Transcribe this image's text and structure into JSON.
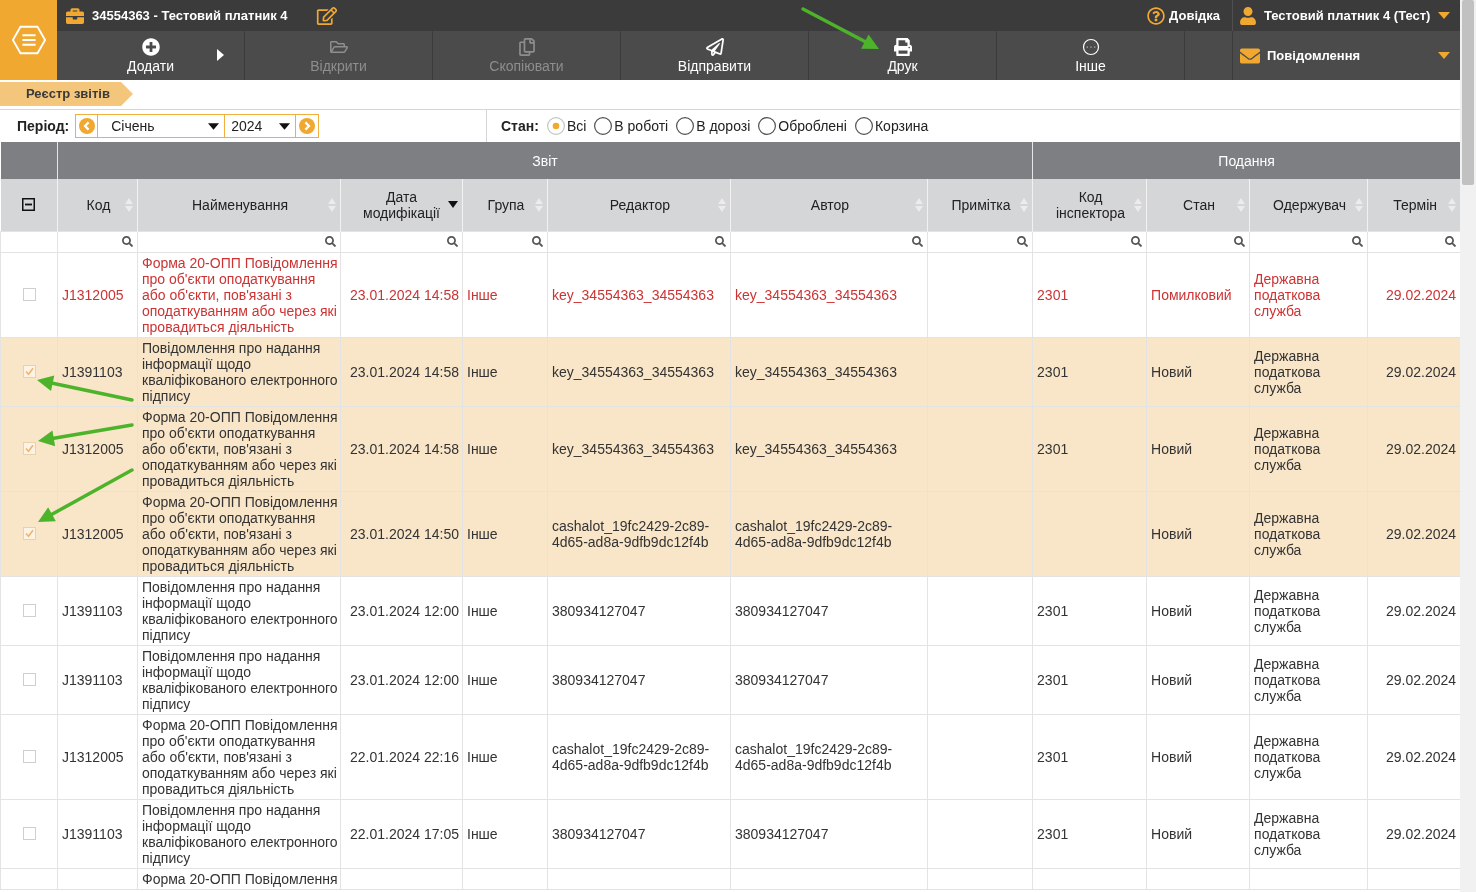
{
  "header": {
    "title": "34554363 - Тестовий платник 4",
    "help": "Довідка",
    "user": "Тестовий платник 4 (Тест)"
  },
  "toolbar": [
    {
      "label": "Додати",
      "disabled": false,
      "has_submenu": true
    },
    {
      "label": "Відкрити",
      "disabled": true,
      "has_submenu": false
    },
    {
      "label": "Скопіювати",
      "disabled": true,
      "has_submenu": false
    },
    {
      "label": "Відправити",
      "disabled": false,
      "has_submenu": false
    },
    {
      "label": "Друк",
      "disabled": false,
      "has_submenu": false
    },
    {
      "label": "Інше",
      "disabled": false,
      "has_submenu": false
    }
  ],
  "messages": {
    "label": "Повідомлення"
  },
  "breadcrumb": "Реєстр звітів",
  "filters": {
    "period_label": "Період:",
    "month": "Січень",
    "year": "2024",
    "status_label": "Стан:",
    "status_options": [
      {
        "label": "Всі",
        "selected": true
      },
      {
        "label": "В роботі",
        "selected": false
      },
      {
        "label": "В дорозі",
        "selected": false
      },
      {
        "label": "Оброблені",
        "selected": false
      },
      {
        "label": "Корзина",
        "selected": false
      }
    ]
  },
  "table": {
    "select_all": {
      "indeterminate": true
    },
    "column_groups": [
      {
        "label": "Звіт",
        "columns": [
          {
            "label": "Код",
            "sorted_descending": false
          },
          {
            "label": "Найменування",
            "sorted_descending": false
          },
          {
            "label": "Дата модифікації",
            "sorted_descending": true
          },
          {
            "label": "Група",
            "sorted_descending": false
          },
          {
            "label": "Редактор",
            "sorted_descending": false
          },
          {
            "label": "Автор",
            "sorted_descending": false
          },
          {
            "label": "Примітка",
            "sorted_descending": false
          }
        ]
      },
      {
        "label": "Подання",
        "columns": [
          {
            "label": "Код інспектора",
            "sorted_descending": false
          },
          {
            "label": "Стан",
            "sorted_descending": false
          },
          {
            "label": "Одержувач",
            "sorted_descending": false
          },
          {
            "label": "Термін",
            "sorted_descending": false
          }
        ]
      }
    ],
    "rows": [
      {
        "checked": false,
        "selected": false,
        "error": true,
        "code": "J1312005",
        "name": "Форма 20-ОПП Повідомлення про об'єкти оподаткування або об'єкти, пов'язані з оподаткуванням або через які провадиться діяльність",
        "modified": "23.01.2024 14:58",
        "group": "Інше",
        "editor": "key_34554363_34554363",
        "author": "key_34554363_34554363",
        "inspector_code": "2301",
        "status": "Помилковий",
        "recipient": "Державна податкова служба",
        "deadline": "29.02.2024"
      },
      {
        "checked": true,
        "selected": true,
        "error": false,
        "code": "J1391103",
        "name": "Повідомлення про надання інформації щодо кваліфікованого електронного підпису",
        "modified": "23.01.2024 14:58",
        "group": "Інше",
        "editor": "key_34554363_34554363",
        "author": "key_34554363_34554363",
        "inspector_code": "2301",
        "status": "Новий",
        "recipient": "Державна податкова служба",
        "deadline": "29.02.2024"
      },
      {
        "checked": true,
        "selected": true,
        "error": false,
        "code": "J1312005",
        "name": "Форма 20-ОПП Повідомлення про об'єкти оподаткування або об'єкти, пов'язані з оподаткуванням або через які провадиться діяльність",
        "modified": "23.01.2024 14:58",
        "group": "Інше",
        "editor": "key_34554363_34554363",
        "author": "key_34554363_34554363",
        "inspector_code": "2301",
        "status": "Новий",
        "recipient": "Державна податкова служба",
        "deadline": "29.02.2024"
      },
      {
        "checked": true,
        "selected": true,
        "error": false,
        "code": "J1312005",
        "name": "Форма 20-ОПП Повідомлення про об'єкти оподаткування або об'єкти, пов'язані з оподаткуванням або через які провадиться діяльність",
        "modified": "23.01.2024 14:50",
        "group": "Інше",
        "editor": "cashalot_19fc2429-2c89-4d65-ad8a-9dfb9dc12f4b",
        "author": "cashalot_19fc2429-2c89-4d65-ad8a-9dfb9dc12f4b",
        "status": "Новий",
        "recipient": "Державна податкова служба",
        "deadline": "29.02.2024"
      },
      {
        "checked": false,
        "selected": false,
        "error": false,
        "code": "J1391103",
        "name": "Повідомлення про надання інформації щодо кваліфікованого електронного підпису",
        "modified": "23.01.2024 12:00",
        "group": "Інше",
        "editor": "380934127047",
        "author": "380934127047",
        "inspector_code": "2301",
        "status": "Новий",
        "recipient": "Державна податкова служба",
        "deadline": "29.02.2024"
      },
      {
        "checked": false,
        "selected": false,
        "error": false,
        "code": "J1391103",
        "name": "Повідомлення про надання інформації щодо кваліфікованого електронного підпису",
        "modified": "23.01.2024 12:00",
        "group": "Інше",
        "editor": "380934127047",
        "author": "380934127047",
        "inspector_code": "2301",
        "status": "Новий",
        "recipient": "Державна податкова служба",
        "deadline": "29.02.2024"
      },
      {
        "checked": false,
        "selected": false,
        "error": false,
        "code": "J1312005",
        "name": "Форма 20-ОПП Повідомлення про об'єкти оподаткування або об'єкти, пов'язані з оподаткуванням або через які провадиться діяльність",
        "modified": "22.01.2024 22:16",
        "group": "Інше",
        "editor": "cashalot_19fc2429-2c89-4d65-ad8a-9dfb9dc12f4b",
        "author": "cashalot_19fc2429-2c89-4d65-ad8a-9dfb9dc12f4b",
        "inspector_code": "2301",
        "status": "Новий",
        "recipient": "Державна податкова служба",
        "deadline": "29.02.2024"
      },
      {
        "checked": false,
        "selected": false,
        "error": false,
        "code": "J1391103",
        "name": "Повідомлення про надання інформації щодо кваліфікованого електронного підпису",
        "modified": "22.01.2024 17:05",
        "group": "Інше",
        "editor": "380934127047",
        "author": "380934127047",
        "inspector_code": "2301",
        "status": "Новий",
        "recipient": "Державна податкова служба",
        "deadline": "29.02.2024"
      },
      {
        "selected": false,
        "error": false,
        "name": "Форма 20-ОПП Повідомлення"
      }
    ]
  }
}
